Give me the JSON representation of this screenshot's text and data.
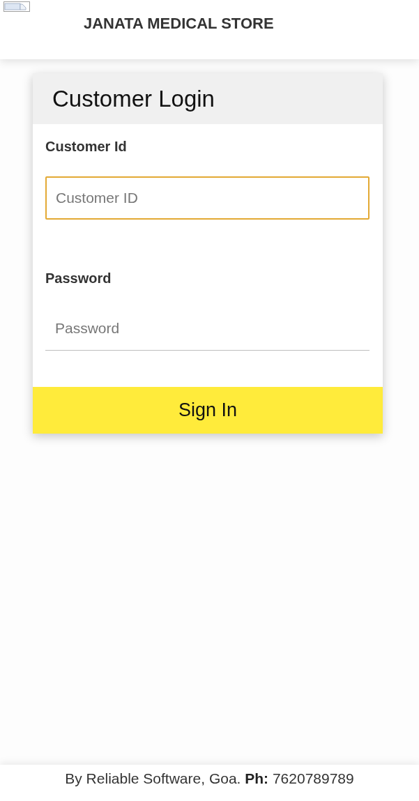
{
  "header": {
    "title": "JANATA MEDICAL STORE"
  },
  "login_card": {
    "title": "Customer Login",
    "fields": [
      {
        "label": "Customer Id",
        "placeholder": "Customer ID",
        "focused": true
      },
      {
        "label": "Password",
        "placeholder": "Password",
        "focused": false
      }
    ],
    "button": "Sign In"
  },
  "footer": {
    "text": "By Reliable Software, Goa. **Ph:** 7620789789"
  }
}
